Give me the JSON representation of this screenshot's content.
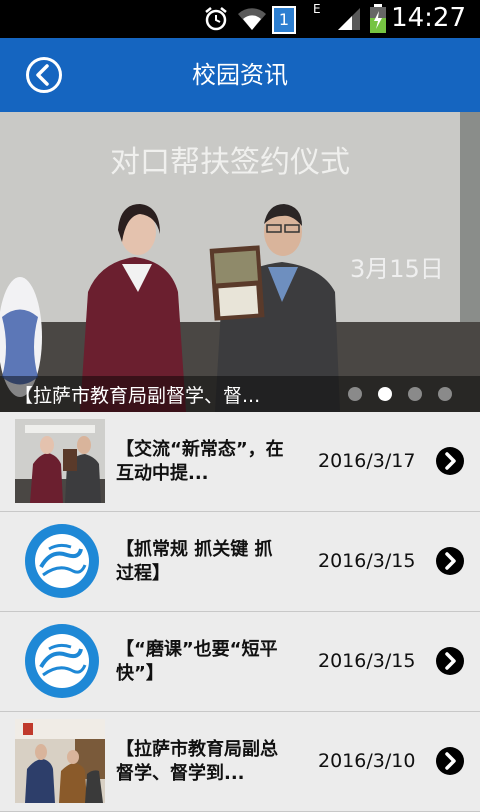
{
  "status_bar": {
    "time": "14:27",
    "notification_count": "1",
    "network_type": "E",
    "icons": [
      "alarm-icon",
      "wifi-icon",
      "notification-badge",
      "signal-icon",
      "battery-charging-icon"
    ]
  },
  "header": {
    "title": "校园资讯",
    "back_icon": "back-arrow-icon",
    "accent_color": "#1565c0"
  },
  "banner": {
    "caption": "【拉萨市教育局副督学、督...",
    "image_sign_text": "对口帮扶签约仪式",
    "image_date_text": "3月15日",
    "slide_count": 4,
    "active_slide": 2
  },
  "news": [
    {
      "title": "【交流“新常态”，在互动中提...",
      "date": "2016/3/17",
      "thumb": "photo-signing"
    },
    {
      "title": "【抓常规 抓关键 抓过程】",
      "date": "2016/3/15",
      "thumb": "school-logo"
    },
    {
      "title": "【“磨课”也要“短平快”】",
      "date": "2016/3/15",
      "thumb": "school-logo"
    },
    {
      "title": "【拉萨市教育局副总督学、督学到...",
      "date": "2016/3/10",
      "thumb": "photo-visit"
    }
  ],
  "icons": {
    "row_chevron": "chevron-right-circle-icon"
  }
}
